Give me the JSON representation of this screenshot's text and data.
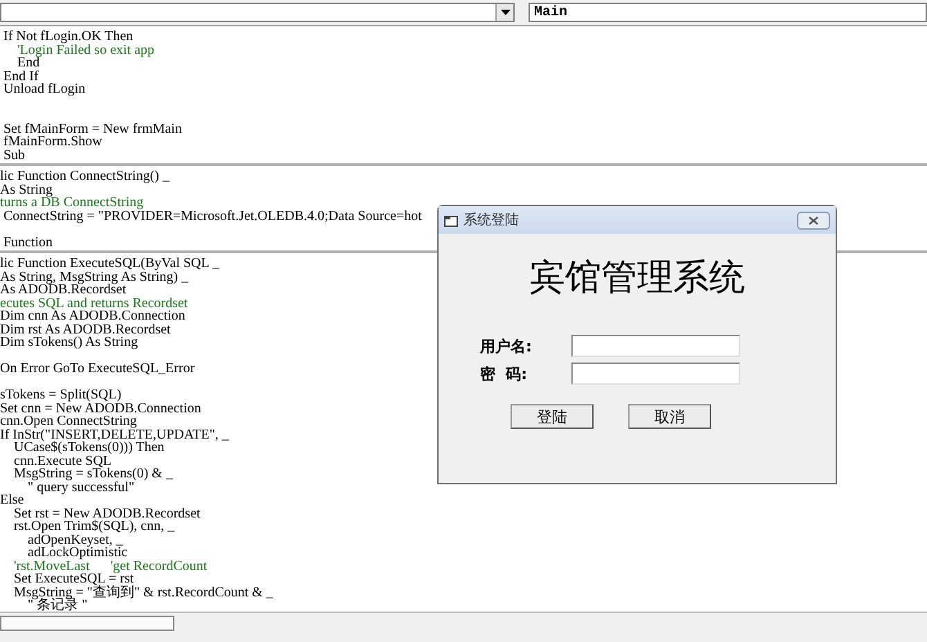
{
  "toolbar": {
    "procedure_combo": {
      "value": "Main"
    }
  },
  "code_sections": [
    {
      "lines": [
        {
          "kind": "code",
          "text": " If Not fLogin.OK Then"
        },
        {
          "kind": "comment",
          "text": "     'Login Failed so exit app"
        },
        {
          "kind": "code",
          "text": "     End"
        },
        {
          "kind": "code",
          "text": " End If"
        },
        {
          "kind": "code",
          "text": " Unload fLogin"
        },
        {
          "kind": "blank"
        },
        {
          "kind": "blank"
        },
        {
          "kind": "code",
          "text": " Set fMainForm = New frmMain"
        },
        {
          "kind": "code",
          "text": " fMainForm.Show"
        },
        {
          "kind": "code",
          "text": " Sub"
        }
      ]
    },
    {
      "lines": [
        {
          "kind": "code",
          "text": "lic Function ConnectString() _"
        },
        {
          "kind": "code",
          "text": "As String"
        },
        {
          "kind": "comment",
          "text": "turns a DB ConnectString"
        },
        {
          "kind": "code",
          "text": " ConnectString = \"PROVIDER=Microsoft.Jet.OLEDB.4.0;Data Source=hot"
        },
        {
          "kind": "blank"
        },
        {
          "kind": "code",
          "text": " Function"
        }
      ]
    },
    {
      "lines": [
        {
          "kind": "code",
          "text": "lic Function ExecuteSQL(ByVal SQL _"
        },
        {
          "kind": "code",
          "text": "As String, MsgString As String) _"
        },
        {
          "kind": "code",
          "text": "As ADODB.Recordset"
        },
        {
          "kind": "comment",
          "text": "ecutes SQL and returns Recordset"
        },
        {
          "kind": "code",
          "text": "Dim cnn As ADODB.Connection"
        },
        {
          "kind": "code",
          "text": "Dim rst As ADODB.Recordset"
        },
        {
          "kind": "code",
          "text": "Dim sTokens() As String"
        },
        {
          "kind": "blank"
        },
        {
          "kind": "code",
          "text": "On Error GoTo ExecuteSQL_Error"
        },
        {
          "kind": "blank"
        },
        {
          "kind": "code",
          "text": "sTokens = Split(SQL)"
        },
        {
          "kind": "code",
          "text": "Set cnn = New ADODB.Connection"
        },
        {
          "kind": "code",
          "text": "cnn.Open ConnectString"
        },
        {
          "kind": "code",
          "text": "If InStr(\"INSERT,DELETE,UPDATE\", _"
        },
        {
          "kind": "code",
          "text": "    UCase$(sTokens(0))) Then"
        },
        {
          "kind": "code",
          "text": "    cnn.Execute SQL"
        },
        {
          "kind": "code",
          "text": "    MsgString = sTokens(0) & _"
        },
        {
          "kind": "code",
          "text": "        \" query successful\""
        },
        {
          "kind": "code",
          "text": "Else"
        },
        {
          "kind": "code",
          "text": "    Set rst = New ADODB.Recordset"
        },
        {
          "kind": "code",
          "text": "    rst.Open Trim$(SQL), cnn, _"
        },
        {
          "kind": "code",
          "text": "        adOpenKeyset, _"
        },
        {
          "kind": "code",
          "text": "        adLockOptimistic"
        },
        {
          "kind": "comment",
          "text": "    'rst.MoveLast      'get RecordCount"
        },
        {
          "kind": "code",
          "text": "    Set ExecuteSQL = rst"
        },
        {
          "kind": "code",
          "text": "    MsgString = \"查询到\" & rst.RecordCount & _"
        },
        {
          "kind": "code",
          "text": "        \" 条记录 \""
        }
      ]
    }
  ],
  "dialog": {
    "title": "系统登陆",
    "heading": "宾馆管理系统",
    "fields": [
      {
        "label": "用户名:"
      },
      {
        "label": "密  码:"
      }
    ],
    "buttons": [
      "登陆",
      "取消"
    ]
  }
}
